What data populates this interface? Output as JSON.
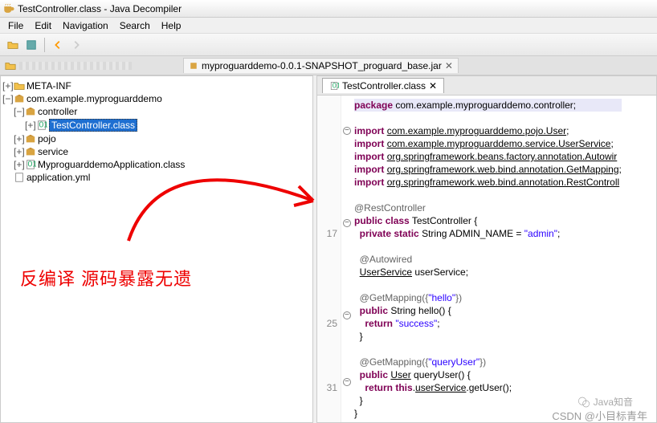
{
  "title": "TestController.class - Java Decompiler",
  "menu": [
    "File",
    "Edit",
    "Navigation",
    "Search",
    "Help"
  ],
  "open_tab": "myproguarddemo-0.0.1-SNAPSHOT_proguard_base.jar",
  "tree": [
    {
      "ind": 0,
      "toggle": "+",
      "icon": "folder",
      "label": "META-INF"
    },
    {
      "ind": 0,
      "toggle": "−",
      "icon": "pkg",
      "label": "com.example.myproguarddemo"
    },
    {
      "ind": 1,
      "toggle": "−",
      "icon": "pkg",
      "label": "controller"
    },
    {
      "ind": 2,
      "toggle": "+",
      "icon": "class",
      "label": "TestController.class",
      "selected": true
    },
    {
      "ind": 1,
      "toggle": "+",
      "icon": "pkg",
      "label": "pojo"
    },
    {
      "ind": 1,
      "toggle": "+",
      "icon": "pkg",
      "label": "service"
    },
    {
      "ind": 1,
      "toggle": "+",
      "icon": "class",
      "label": "MyproguarddemoApplication.class"
    },
    {
      "ind": 0,
      "toggle": "",
      "icon": "file",
      "label": "application.yml"
    }
  ],
  "code_tab": "TestController.class",
  "code": {
    "package": "package com.example.myproguarddemo.controller;",
    "imports": [
      "com.example.myproguarddemo.pojo.User",
      "com.example.myproguarddemo.service.UserService",
      "org.springframework.beans.factory.annotation.Autowir",
      "org.springframework.web.bind.annotation.GetMapping",
      "org.springframework.web.bind.annotation.RestControll"
    ],
    "ann_rest": "@RestController",
    "class_decl": "public class TestController {",
    "ln17": "17",
    "field": "  private static String ADMIN_NAME = \"admin\";",
    "ann_auto": "  @Autowired",
    "svc_field": "  UserService userService;",
    "ann_get1": "  @GetMapping({\"hello\"})",
    "m1_sig": "  public String hello() {",
    "ln25": "25",
    "m1_ret": "    return \"success\";",
    "m1_close": "  }",
    "ann_get2": "  @GetMapping({\"queryUser\"})",
    "m2_sig": "  public User queryUser() {",
    "ln31": "31",
    "m2_ret": "    return this.userService.getUser();",
    "m2_close": "  }",
    "cls_close": "}"
  },
  "annotation_text": "反编译 源码暴露无遗",
  "watermark1": "Java知音",
  "watermark2": "CSDN @小目标青年"
}
